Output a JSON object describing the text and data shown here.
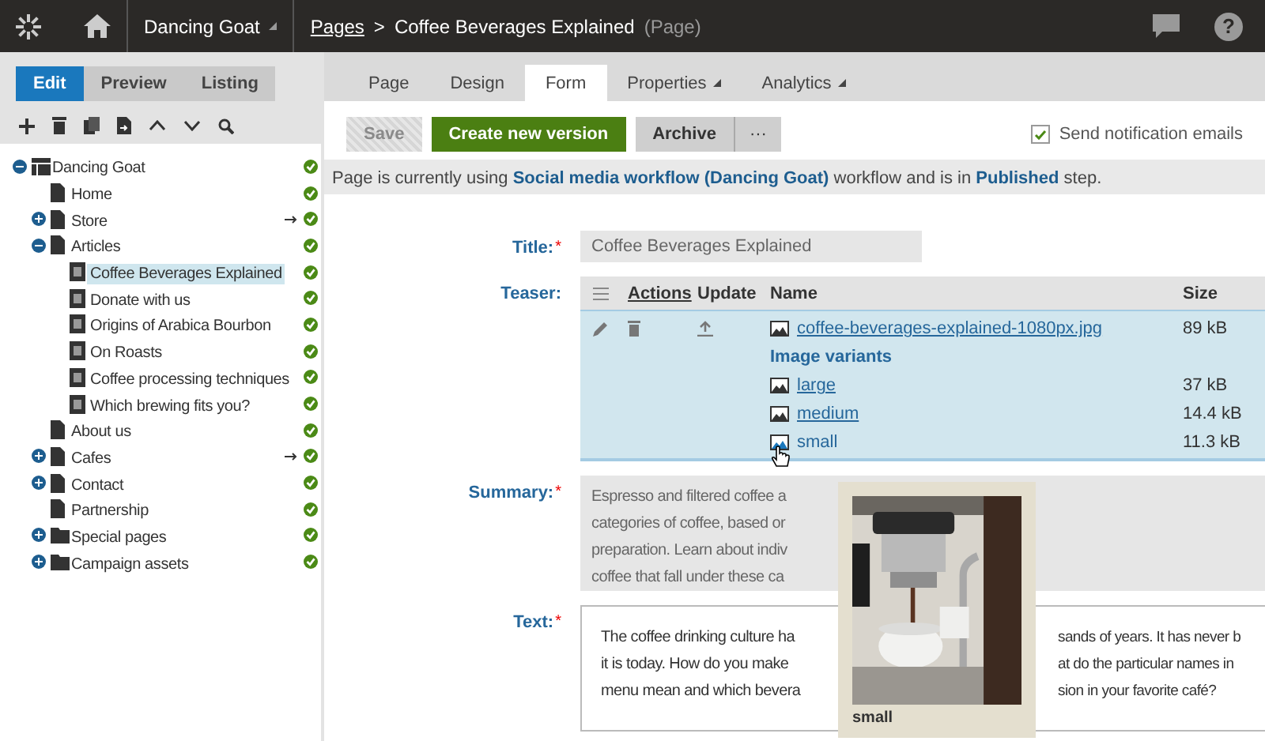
{
  "topbar": {
    "site": "Dancing Goat",
    "breadcrumb_link": "Pages",
    "separator": ">",
    "page_title": "Coffee Beverages Explained",
    "page_type": "(Page)",
    "help": "?"
  },
  "mode_tabs": [
    {
      "label": "Edit",
      "selected": true
    },
    {
      "label": "Preview",
      "selected": false
    },
    {
      "label": "Listing",
      "selected": false
    }
  ],
  "tree": [
    {
      "label": "Dancing Goat",
      "kind": "site",
      "expanded": true,
      "selected": false,
      "redirect": false,
      "children": [
        {
          "label": "Home",
          "kind": "page",
          "selected": false,
          "redirect": false
        },
        {
          "label": "Store",
          "kind": "page",
          "expanded": false,
          "selected": false,
          "redirect": true
        },
        {
          "label": "Articles",
          "kind": "page",
          "expanded": true,
          "selected": false,
          "redirect": false,
          "children": [
            {
              "label": "Coffee Beverages Explained",
              "kind": "article",
              "selected": true,
              "redirect": false
            },
            {
              "label": "Donate with us",
              "kind": "article",
              "selected": false,
              "redirect": false
            },
            {
              "label": "Origins of Arabica Bourbon",
              "kind": "article",
              "selected": false,
              "redirect": false
            },
            {
              "label": "On Roasts",
              "kind": "article",
              "selected": false,
              "redirect": false
            },
            {
              "label": "Coffee processing techniques",
              "kind": "article",
              "selected": false,
              "redirect": false
            },
            {
              "label": "Which brewing fits you?",
              "kind": "article",
              "selected": false,
              "redirect": false
            }
          ]
        },
        {
          "label": "About us",
          "kind": "page",
          "selected": false,
          "redirect": false
        },
        {
          "label": "Cafes",
          "kind": "page",
          "expanded": false,
          "selected": false,
          "redirect": true
        },
        {
          "label": "Contact",
          "kind": "page",
          "expanded": false,
          "selected": false,
          "redirect": false
        },
        {
          "label": "Partnership",
          "kind": "page",
          "selected": false,
          "redirect": false
        },
        {
          "label": "Special pages",
          "kind": "folder",
          "expanded": false,
          "selected": false,
          "redirect": false
        },
        {
          "label": "Campaign assets",
          "kind": "folder",
          "expanded": false,
          "selected": false,
          "redirect": false
        }
      ]
    }
  ],
  "tabs": [
    {
      "label": "Page",
      "selected": false,
      "dropdown": false
    },
    {
      "label": "Design",
      "selected": false,
      "dropdown": false
    },
    {
      "label": "Form",
      "selected": true,
      "dropdown": false
    },
    {
      "label": "Properties",
      "selected": false,
      "dropdown": true
    },
    {
      "label": "Analytics",
      "selected": false,
      "dropdown": true
    }
  ],
  "actions": [
    {
      "label": "Save",
      "kind": "disabled"
    },
    {
      "label": "Create new version",
      "kind": "primary"
    },
    {
      "label": "Archive",
      "kind": "default"
    },
    {
      "label": "···",
      "kind": "more"
    }
  ],
  "notification": {
    "label": "Send notification emails",
    "checked": true
  },
  "workflow_message": "Page is currently using **Social media workflow (Dancing Goat)** workflow and is in **Published** step.",
  "form": {
    "title": {
      "label": "Title:",
      "required_mark": "*",
      "value": "Coffee Beverages Explained"
    },
    "teaser": {
      "label": "Teaser:",
      "columns": [
        "Actions",
        "Update",
        "Name",
        "Size"
      ],
      "file": {
        "name": "coffee-beverages-explained-1080px.jpg",
        "size": "89 kB"
      },
      "variants_heading": "Image variants",
      "variants": [
        {
          "name": "large",
          "size": "37 kB",
          "hovered": false
        },
        {
          "name": "medium",
          "size": "14.4 kB",
          "hovered": false
        },
        {
          "name": "small",
          "size": "11.3 kB",
          "hovered": true
        }
      ]
    },
    "summary": {
      "label": "Summary:",
      "required_mark": "*",
      "lines": [
        "Espresso and filtered coffee a",
        "categories of coffee, based or",
        "preparation. Learn about indiv",
        "coffee that fall under these ca"
      ]
    },
    "text": {
      "label": "Text:",
      "required_mark": "*",
      "lines": [
        [
          "The coffee drinking culture ha",
          "sands of years. It has never b"
        ],
        [
          "it is today. How do you make",
          "at do the particular names in"
        ],
        [
          "menu mean and which bevera",
          "sion in your favorite café?"
        ]
      ]
    }
  },
  "preview_popup": {
    "caption": "small"
  }
}
